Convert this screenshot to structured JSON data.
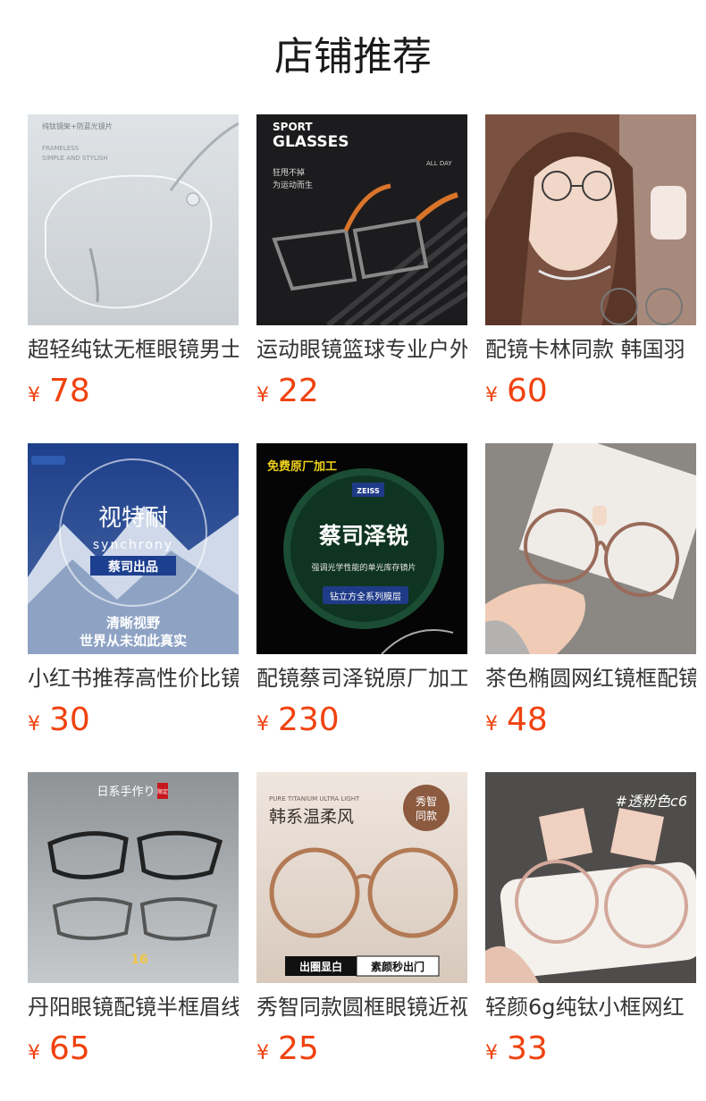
{
  "header": {
    "title": "店铺推荐"
  },
  "currency_symbol": "¥",
  "products": [
    {
      "name": "超轻纯钛无框眼镜男士",
      "price": "78",
      "image": {
        "icon": "rimless-titanium-glasses-image",
        "line1": "纯钛镜架+防蓝光镜片",
        "line2": "FRAMELESS",
        "line3": "SIMPLE AND STYLISH"
      }
    },
    {
      "name": "运动眼镜篮球专业户外",
      "price": "22",
      "image": {
        "icon": "sport-glasses-image",
        "line1": "SPORT",
        "line2": "GLASSES",
        "line3": "狂甩不掉",
        "line4": "为运动而生",
        "line5": "ALL DAY"
      }
    },
    {
      "name": "配镜卡林同款 韩国羽",
      "price": "60",
      "image": {
        "icon": "model-wearing-glasses-image"
      }
    },
    {
      "name": "小红书推荐高性价比镜",
      "price": "30",
      "image": {
        "icon": "lens-mountain-image",
        "line1": "视特耐",
        "line2": "synchrony",
        "line3": "蔡司出品",
        "line4": "清晰视野",
        "line5": "世界从未如此真实"
      }
    },
    {
      "name": "配镜蔡司泽锐原厂加工",
      "price": "230",
      "image": {
        "icon": "zeiss-lens-image",
        "line1": "免费原厂加工",
        "line2": "ZEISS",
        "line3": "蔡司泽锐",
        "line4": "强调光学性能的单光库存镜片",
        "line5": "钻立方全系列膜层"
      }
    },
    {
      "name": "茶色椭圆网红镜框配镜",
      "price": "48",
      "image": {
        "icon": "tea-color-glasses-hand-image"
      }
    },
    {
      "name": "丹阳眼镜配镜半框眉线",
      "price": "65",
      "image": {
        "icon": "half-frame-glasses-image",
        "line1": "日系手作り",
        "line2": "限定",
        "line3": "16"
      }
    },
    {
      "name": "秀智同款圆框眼镜近视",
      "price": "25",
      "image": {
        "icon": "round-frame-glasses-image",
        "line1": "PURE TITANIUM ULTRA LIGHT",
        "line2": "韩系温柔风",
        "line3": "秀智",
        "line4": "同款",
        "line5": "出圈显白",
        "line6": "素颜秒出门"
      }
    },
    {
      "name": "轻颜6g纯钛小框网红",
      "price": "33",
      "image": {
        "icon": "pink-frame-glasses-case-image",
        "line1": "#透粉色c6"
      }
    }
  ],
  "colors": {
    "price": "#f0420f",
    "title": "#1a1a1a",
    "name": "#333333"
  }
}
